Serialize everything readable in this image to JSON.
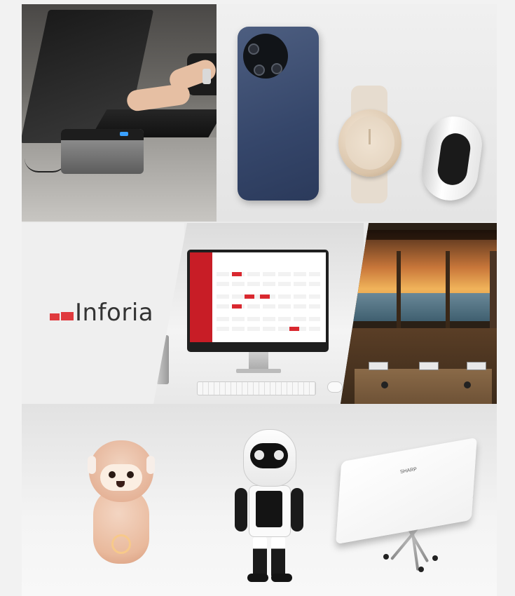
{
  "collage": {
    "logo": {
      "brand_text": "Inforia",
      "accent_color": "#e03a3e"
    },
    "projector_logo": "SHARP",
    "panels": [
      "laptop-and-card-terminal",
      "smartphone-smartwatch-smartring",
      "inforia-logo",
      "desktop-monitor-app",
      "tv-resort-view",
      "sloth-robot",
      "robohon-robot",
      "tripod-device"
    ]
  }
}
